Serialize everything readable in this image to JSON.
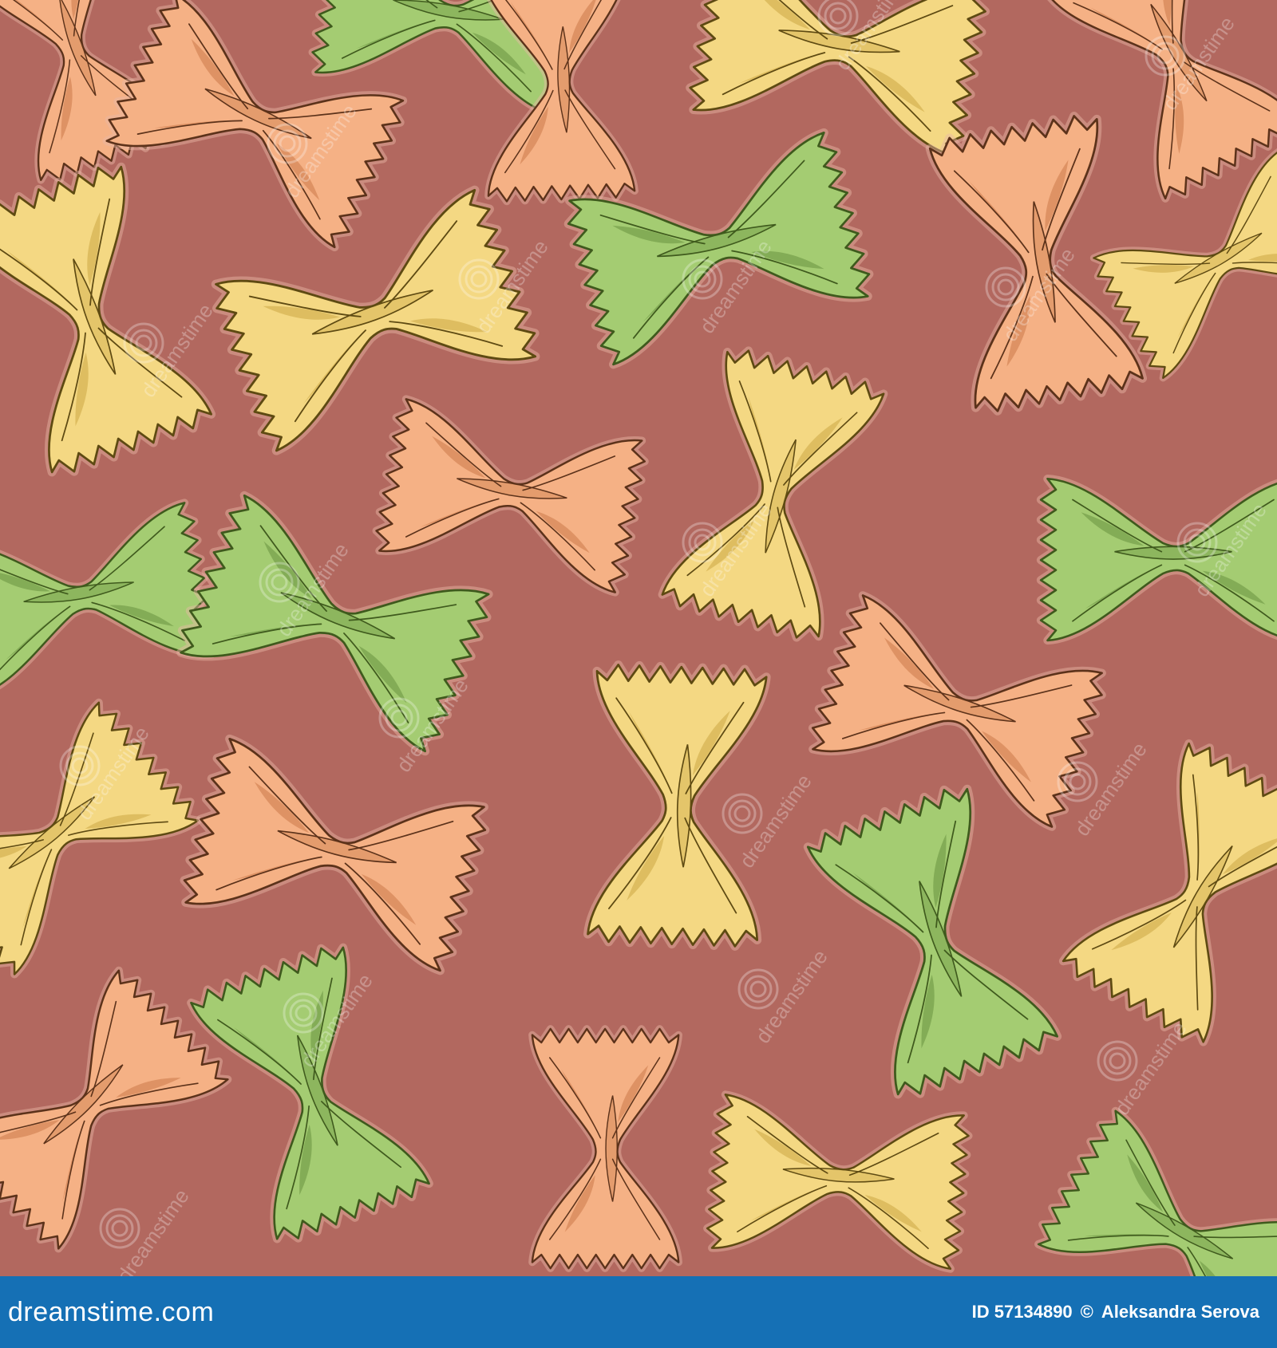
{
  "image": {
    "background_color": "#b2685f",
    "pasta_colors": {
      "green": {
        "fill": "#a4cc72",
        "shade": "#7ea651",
        "stroke": "#3f5a1d"
      },
      "yellow": {
        "fill": "#f4d883",
        "shade": "#d9b95a",
        "stroke": "#5e4a12"
      },
      "orange": {
        "fill": "#f5b185",
        "shade": "#d98d5e",
        "stroke": "#5c321a"
      }
    },
    "watermark_text": "dreamstime"
  },
  "footer": {
    "logo": "dreamstime.com",
    "id_label": "ID 57134890",
    "separator": "©",
    "author": "Aleksandra Serova",
    "bar_color": "#1570b5",
    "text_color": "#ffffff"
  }
}
